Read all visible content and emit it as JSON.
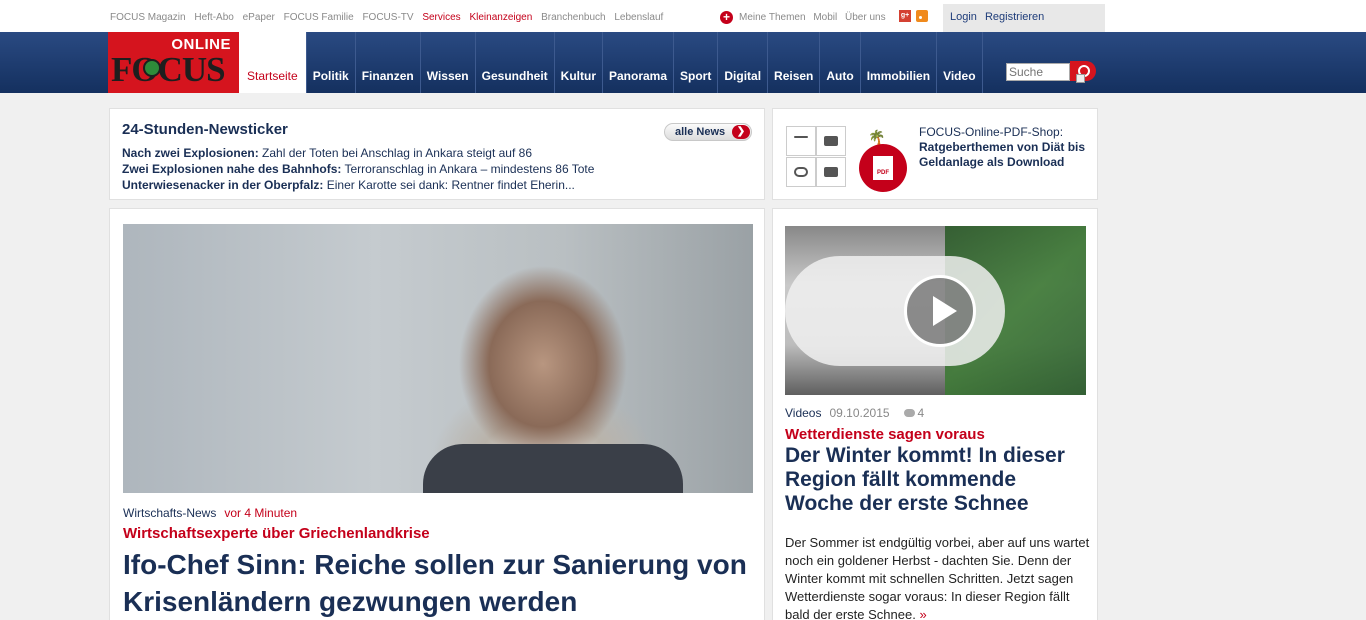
{
  "topbar": {
    "links": [
      "FOCUS Magazin",
      "Heft-Abo",
      "ePaper",
      "FOCUS Familie",
      "FOCUS-TV"
    ],
    "highlight_links": [
      "Services",
      "Kleinanzeigen"
    ],
    "links_after": [
      "Branchenbuch",
      "Lebenslauf"
    ],
    "right_links": [
      "Meine Themen",
      "Mobil",
      "Über uns"
    ],
    "login": "Login",
    "register": "Registrieren"
  },
  "logo": {
    "online": "ONLINE",
    "focus": "FOCUS"
  },
  "nav": {
    "items": [
      "Startseite",
      "Politik",
      "Finanzen",
      "Wissen",
      "Gesundheit",
      "Kultur",
      "Panorama",
      "Sport",
      "Digital",
      "Reisen",
      "Auto",
      "Immobilien",
      "Video"
    ],
    "search_placeholder": "Suche"
  },
  "ticker": {
    "title": "24-Stunden-Newsticker",
    "all_news": "alle News",
    "items": [
      {
        "bold": "Nach zwei Explosionen:",
        "text": " Zahl der Toten bei Anschlag in Ankara steigt auf 86"
      },
      {
        "bold": "Zwei Explosionen nahe des Bahnhofs:",
        "text": " Terroranschlag in Ankara – mindestens 86 Tote"
      },
      {
        "bold": "Unterwiesenacker in der Oberpfalz:",
        "text": " Einer Karotte sei dank: Rentner findet Eherin..."
      }
    ]
  },
  "pdfshop": {
    "title": "FOCUS-Online-PDF-Shop:",
    "subtitle": "Ratgeberthemen von Diät bis Geldanlage als Download",
    "badge": "PDF"
  },
  "main_story": {
    "category": "Wirtschafts-News",
    "time": "vor 4 Minuten",
    "kicker": "Wirtschaftsexperte über Griechenlandkrise",
    "headline": "Ifo-Chef Sinn: Reiche sollen zur Sanierung von Krisenländern gezwungen werden"
  },
  "side_story": {
    "category": "Videos",
    "date": "09.10.2015",
    "comments": "4",
    "kicker": "Wetterdienste sagen voraus",
    "headline": "Der Winter kommt! In dieser Region fällt kommende Woche der erste Schnee",
    "teaser": "Der Sommer ist endgültig vorbei, aber auf uns wartet noch ein goldener Herbst - dachten Sie. Denn der Winter kommt mit schnellen Schritten. Jetzt sagen Wetterdienste sogar voraus: In dieser Region fällt bald der erste Schnee.",
    "more": "»"
  },
  "colors": {
    "brand_red": "#d5141e",
    "nav_blue": "#1e3a6e",
    "headline_blue": "#1a2f55"
  }
}
